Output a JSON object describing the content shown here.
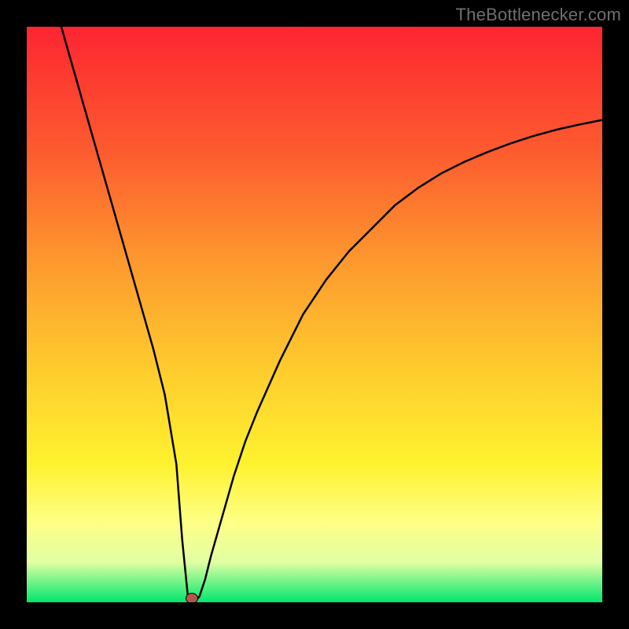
{
  "watermark": "TheBottlenecker.com",
  "colors": {
    "bg": "#000000",
    "top": "#fd2531",
    "mid1": "#fd5c2f",
    "mid2": "#fd962e",
    "mid3": "#fec82d",
    "mid4": "#fef22f",
    "mid5": "#feff85",
    "mid6": "#e2ffa3",
    "bottom": "#00e76d",
    "curve": "#000000",
    "marker_fill": "#b2574d",
    "marker_stroke": "#000000"
  },
  "chart_data": {
    "type": "line",
    "title": "",
    "xlabel": "",
    "ylabel": "",
    "x_range": [
      0,
      100
    ],
    "y_range": [
      0,
      100
    ],
    "series": [
      {
        "name": "bottleneck-curve",
        "x": [
          6,
          8,
          10,
          12,
          14,
          16,
          18,
          20,
          22,
          24,
          26,
          27,
          28,
          29,
          30,
          31,
          32,
          34,
          36,
          38,
          40,
          44,
          48,
          52,
          56,
          60,
          64,
          68,
          72,
          76,
          80,
          84,
          88,
          92,
          96,
          100
        ],
        "y": [
          100,
          93,
          86,
          79,
          72,
          65,
          58,
          51,
          44,
          36,
          24,
          11,
          1,
          0,
          1,
          4,
          8,
          15,
          22,
          28,
          33,
          42,
          50,
          56,
          61,
          65,
          69,
          72,
          74.5,
          76.5,
          78.2,
          79.7,
          81,
          82.1,
          83,
          83.8
        ]
      }
    ],
    "marker": {
      "x": 28.7,
      "y": 0.7
    },
    "gradient_stops": [
      {
        "pos": 0.0,
        "key": "top"
      },
      {
        "pos": 0.22,
        "key": "mid1"
      },
      {
        "pos": 0.4,
        "key": "mid2"
      },
      {
        "pos": 0.58,
        "key": "mid3"
      },
      {
        "pos": 0.76,
        "key": "mid4"
      },
      {
        "pos": 0.86,
        "key": "mid5"
      },
      {
        "pos": 0.93,
        "key": "mid6"
      },
      {
        "pos": 1.0,
        "key": "bottom"
      }
    ]
  }
}
